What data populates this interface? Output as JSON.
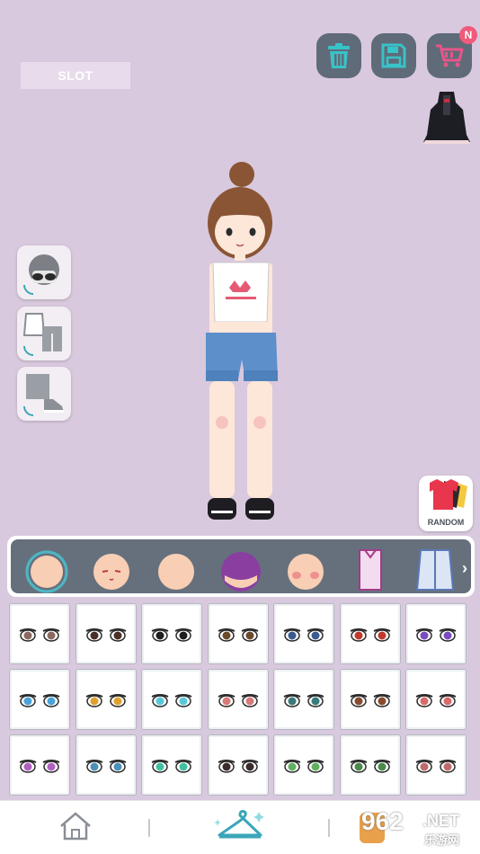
{
  "slot": {
    "label": "SLOT"
  },
  "toolbar": {
    "badge": "N",
    "delete_icon": "trash-icon",
    "save_icon": "floppy-disk-icon",
    "shop_icon": "cart-icon"
  },
  "side_menu": {
    "items": [
      "hair-accessory-toggle",
      "outfit-toggle",
      "shoes-toggle"
    ]
  },
  "random": {
    "label": "RANDOM"
  },
  "categories": [
    "face-selected",
    "face-blush",
    "face-plain",
    "hair-purple",
    "face-cheeks",
    "top-shirt",
    "outer-coat"
  ],
  "eye_grid": {
    "rows": 3,
    "cols": 7,
    "selected": "eye-options"
  },
  "colors": {
    "background": "#d9c9de",
    "panel": "#66707d",
    "accent": "#4db7c5",
    "badge": "#f15a7a"
  },
  "watermark": {
    "number": "962",
    "suffix": ".NET",
    "sub": "乐游网"
  }
}
